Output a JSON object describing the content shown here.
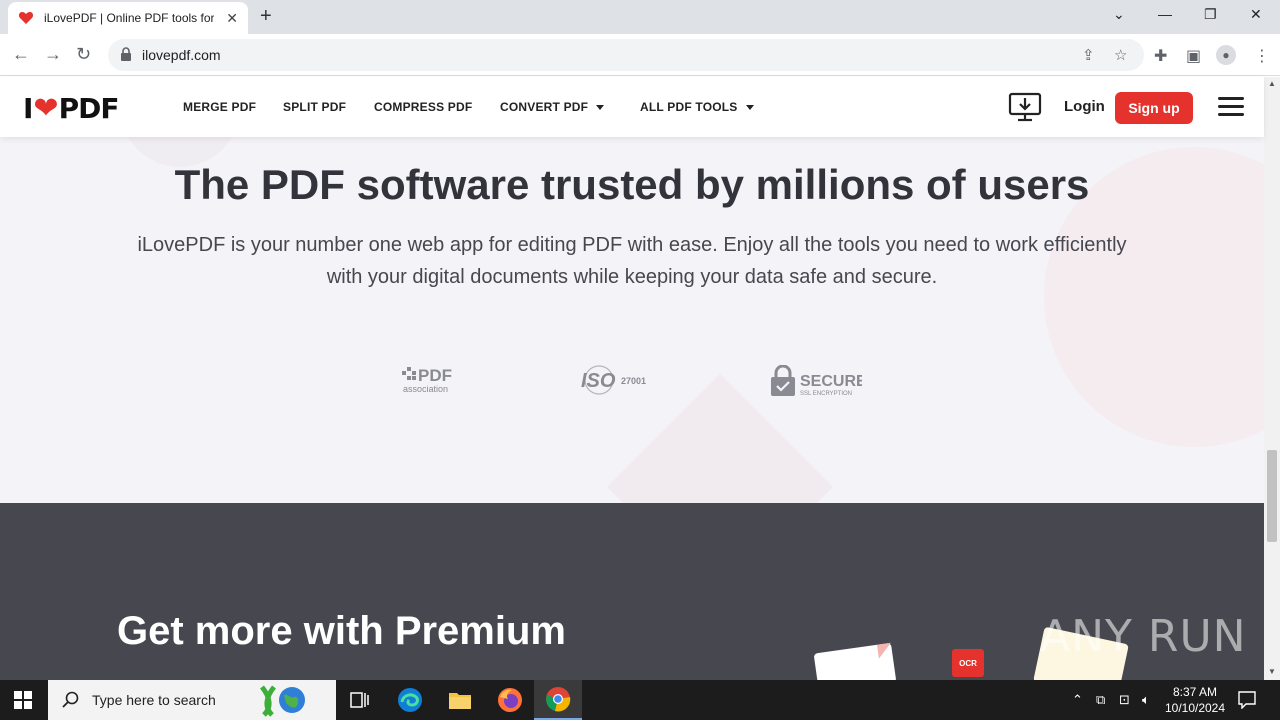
{
  "browser": {
    "tab_title": "iLovePDF | Online PDF tools for PDF lovers",
    "tab_close": "✕",
    "new_tab": "+",
    "url": "ilovepdf.com"
  },
  "site": {
    "logo_left": "I",
    "logo_heart": "❤",
    "logo_right": "PDF",
    "nav": {
      "merge": "MERGE PDF",
      "split": "SPLIT PDF",
      "compress": "COMPRESS PDF",
      "convert": "CONVERT PDF",
      "all_tools": "ALL PDF TOOLS"
    },
    "login": "Login",
    "signup": "Sign up"
  },
  "hero": {
    "title": "The PDF software trusted by millions of users",
    "description": "iLovePDF is your number one web app for editing PDF with ease. Enjoy all the tools you need to work efficiently with your digital documents while keeping your data safe and secure.",
    "badges": {
      "pdf_main": "PDF",
      "pdf_sub": "association",
      "iso_main": "ISO",
      "iso_num": "27001",
      "ssl_main": "SECURE",
      "ssl_sub": "SSL ENCRYPTION"
    }
  },
  "premium": {
    "title": "Get more with Premium",
    "ocr_label": "OCR",
    "watermark": "ANY RUN"
  },
  "taskbar": {
    "search_placeholder": "Type here to search",
    "time": "8:37 AM",
    "date": "10/10/2024"
  },
  "colors": {
    "brand_red": "#e5322d",
    "premium_bg": "#47474f",
    "hero_bg": "#f4f3f8"
  }
}
